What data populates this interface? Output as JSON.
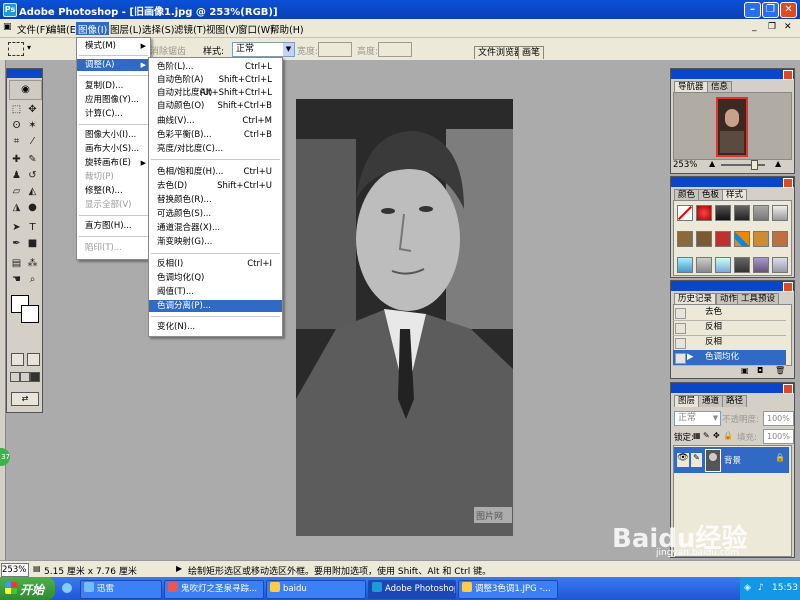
{
  "titlebar": {
    "title": "Adobe Photoshop - [旧画像1.jpg @ 253%(RGB)]",
    "app_icon_text": "Ps"
  },
  "menubar": {
    "items": [
      "文件(F)",
      "编辑(E)",
      "图像(I)",
      "图层(L)",
      "选择(S)",
      "滤镜(T)",
      "视图(V)",
      "窗口(W)",
      "帮助(H)"
    ],
    "active_index": 2
  },
  "optbar": {
    "clear_alias": "消除锯齿",
    "style_label": "样式:",
    "style_value": "正常",
    "width_label": "宽度:",
    "height_label": "高度:",
    "tab_file_browser": "文件浏览器",
    "tab_brushes": "画笔"
  },
  "image_menu": {
    "items": [
      {
        "label": "模式(M)",
        "arrow": true
      },
      {
        "label": "调整(A)",
        "arrow": true,
        "highlight": true
      },
      {
        "label": "复制(D)..."
      },
      {
        "label": "应用图像(Y)..."
      },
      {
        "label": "计算(C)..."
      },
      {
        "label": "图像大小(I)..."
      },
      {
        "label": "画布大小(S)..."
      },
      {
        "label": "旋转画布(E)",
        "arrow": true
      },
      {
        "label": "裁切(P)",
        "disabled": true
      },
      {
        "label": "修整(R)..."
      },
      {
        "label": "显示全部(V)",
        "disabled": true
      },
      {
        "label": "直方图(H)..."
      },
      {
        "label": "陷印(T)...",
        "disabled": true
      }
    ]
  },
  "adjust_menu": {
    "items": [
      {
        "label": "色阶(L)...",
        "shortcut": "Ctrl+L"
      },
      {
        "label": "自动色阶(A)",
        "shortcut": "Shift+Ctrl+L"
      },
      {
        "label": "自动对比度(U)",
        "shortcut": "Alt+Shift+Ctrl+L"
      },
      {
        "label": "自动颜色(O)",
        "shortcut": "Shift+Ctrl+B"
      },
      {
        "label": "曲线(V)...",
        "shortcut": "Ctrl+M"
      },
      {
        "label": "色彩平衡(B)...",
        "shortcut": "Ctrl+B"
      },
      {
        "label": "亮度/对比度(C)...",
        "shortcut": ""
      },
      {
        "label": "色相/饱和度(H)...",
        "shortcut": "Ctrl+U"
      },
      {
        "label": "去色(D)",
        "shortcut": "Shift+Ctrl+U"
      },
      {
        "label": "替换颜色(R)...",
        "shortcut": ""
      },
      {
        "label": "可选颜色(S)...",
        "shortcut": ""
      },
      {
        "label": "通道混合器(X)...",
        "shortcut": ""
      },
      {
        "label": "渐变映射(G)...",
        "shortcut": ""
      },
      {
        "label": "反相(I)",
        "shortcut": "Ctrl+I"
      },
      {
        "label": "色调均化(Q)",
        "shortcut": ""
      },
      {
        "label": "阈值(T)...",
        "shortcut": ""
      },
      {
        "label": "色调分离(P)...",
        "shortcut": "",
        "highlight": true
      },
      {
        "label": "变化(N)...",
        "shortcut": ""
      }
    ]
  },
  "navigator": {
    "tab_nav": "导航器",
    "tab_info": "信息",
    "zoom": "253%"
  },
  "swatches": {
    "tab_color": "颜色",
    "tab_swatch": "色板",
    "tab_style": "样式"
  },
  "history": {
    "tab_history": "历史记录",
    "tab_actions": "动作",
    "tab_presets": "工具预设",
    "items": [
      "去色",
      "反相",
      "反相",
      "色调均化"
    ]
  },
  "layers": {
    "tab_layers": "图层",
    "tab_channels": "通道",
    "tab_paths": "路径",
    "mode": "正常",
    "opacity_label": "不透明度:",
    "opacity": "100%",
    "lock_label": "锁定:",
    "fill_label": "填充:",
    "fill": "100%",
    "layer_name": "背景"
  },
  "statusbar": {
    "zoom": "253%",
    "size": "5.15 厘米 x 7.76 厘米",
    "hint": "绘制矩形选区或移动选区外框。要用附加选项，使用 Shift、Alt 和 Ctrl 键。"
  },
  "taskbar": {
    "start": "开始",
    "tasks": [
      "迅雷",
      "鬼吹灯之圣泉寻踪...",
      "baidu",
      "Adobe Photoshop ...",
      "调整3色调1.JPG -..."
    ],
    "time": "15:53"
  },
  "watermark": {
    "brand": "Baidu经验",
    "url": "jingyan.baidu.com"
  },
  "photo_watermark": "图片网"
}
